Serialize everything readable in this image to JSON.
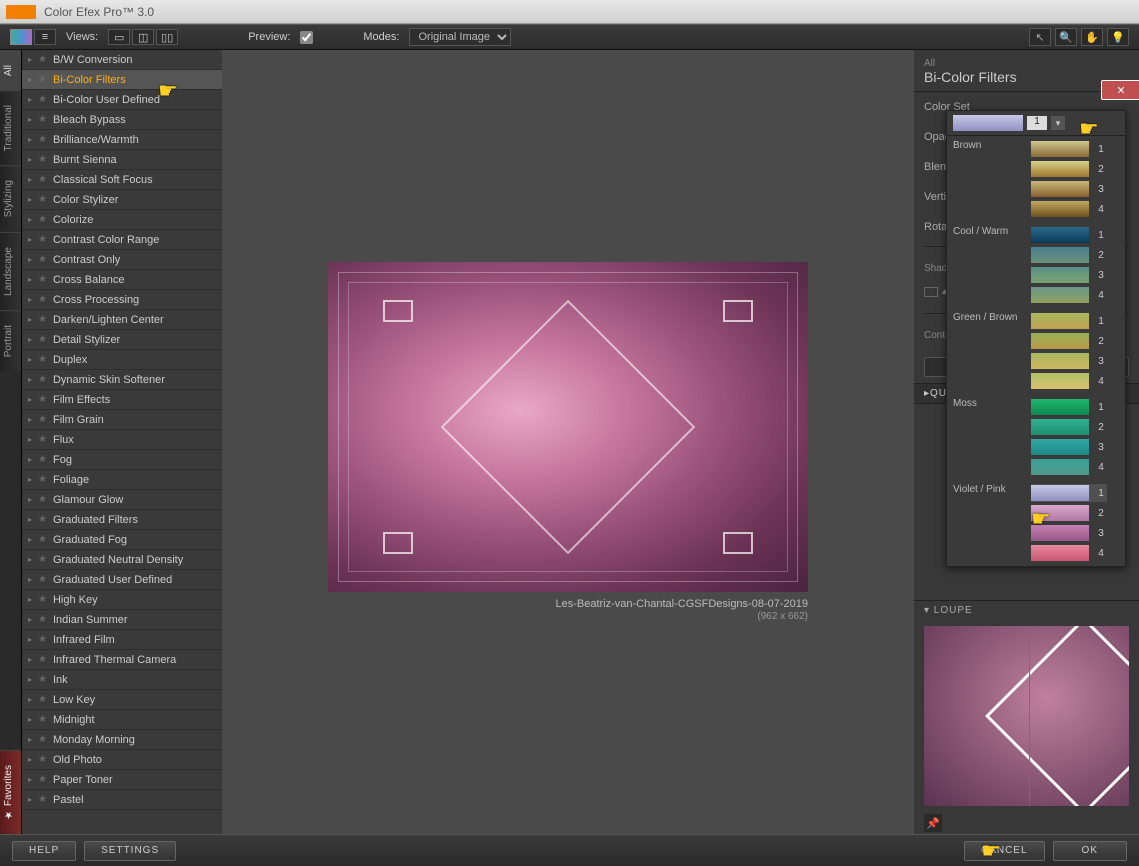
{
  "app_title": "Color Efex Pro™ 3.0",
  "toolbar": {
    "views_label": "Views:",
    "preview_label": "Preview:",
    "preview_checked": true,
    "modes_label": "Modes:",
    "modes_value": "Original Image"
  },
  "vtabs": [
    "All",
    "Traditional",
    "Stylizing",
    "Landscape",
    "Portrait"
  ],
  "vtab_selected": "All",
  "vtab_favorites": "★ Favorites",
  "filters": [
    "B/W Conversion",
    "Bi-Color Filters",
    "Bi-Color User Defined",
    "Bleach Bypass",
    "Brilliance/Warmth",
    "Burnt Sienna",
    "Classical Soft Focus",
    "Color Stylizer",
    "Colorize",
    "Contrast Color Range",
    "Contrast Only",
    "Cross Balance",
    "Cross Processing",
    "Darken/Lighten Center",
    "Detail Stylizer",
    "Duplex",
    "Dynamic Skin Softener",
    "Film Effects",
    "Film Grain",
    "Flux",
    "Fog",
    "Foliage",
    "Glamour Glow",
    "Graduated Filters",
    "Graduated Fog",
    "Graduated Neutral Density",
    "Graduated User Defined",
    "High Key",
    "Indian Summer",
    "Infrared Film",
    "Infrared Thermal Camera",
    "Ink",
    "Low Key",
    "Midnight",
    "Monday Morning",
    "Old Photo",
    "Paper Toner",
    "Pastel"
  ],
  "filter_selected": "Bi-Color Filters",
  "preview": {
    "caption": "Les-Beatriz-van-Chantal-CGSFDesigns-08-07-2019",
    "dims": "(962 x 662)"
  },
  "right": {
    "category": "All",
    "filter_name": "Bi-Color Filters",
    "params": [
      "Color Set",
      "Opacity",
      "Blend",
      "Vertical Shift",
      "Rotation"
    ],
    "shadows_label": "Shadows / Highlights",
    "control_points_label": "Control Points",
    "quick_save": "▸QUICK SAVE",
    "loupe_label": "▾ LOUPE"
  },
  "color_set": {
    "current_value": "1",
    "groups": [
      {
        "name": "Brown",
        "swatches": [
          {
            "n": "1",
            "g": "linear-gradient(#d0c890,#8a6838)"
          },
          {
            "n": "2",
            "g": "linear-gradient(#d8d088,#a07830)"
          },
          {
            "n": "3",
            "g": "linear-gradient(#c8b878,#8a6030)"
          },
          {
            "n": "4",
            "g": "linear-gradient(#c0a860,#705020)"
          }
        ]
      },
      {
        "name": "Cool / Warm",
        "swatches": [
          {
            "n": "1",
            "g": "linear-gradient(#2a6888,#0a3858)"
          },
          {
            "n": "2",
            "g": "linear-gradient(#4a8090,#6a9078)"
          },
          {
            "n": "3",
            "g": "linear-gradient(#5a9088,#7aa070)"
          },
          {
            "n": "4",
            "g": "linear-gradient(#6a988a,#90a060)"
          }
        ]
      },
      {
        "name": "Green / Brown",
        "swatches": [
          {
            "n": "1",
            "g": "linear-gradient(#a8b860,#c0a050)"
          },
          {
            "n": "2",
            "g": "linear-gradient(#98b058,#b89848)"
          },
          {
            "n": "3",
            "g": "linear-gradient(#a8b860,#d0b860)"
          },
          {
            "n": "4",
            "g": "linear-gradient(#b0c068,#d8c070)"
          }
        ]
      },
      {
        "name": "Moss",
        "swatches": [
          {
            "n": "1",
            "g": "linear-gradient(#20b870,#108850)"
          },
          {
            "n": "2",
            "g": "linear-gradient(#30b090,#209070)"
          },
          {
            "n": "3",
            "g": "linear-gradient(#30a8a0,#208888)"
          },
          {
            "n": "4",
            "g": "linear-gradient(#38a098,#509888)"
          }
        ]
      },
      {
        "name": "Violet / Pink",
        "swatches": [
          {
            "n": "1",
            "g": "linear-gradient(#c8c8e8,#9090c0)"
          },
          {
            "n": "2",
            "g": "linear-gradient(#d8a8c8,#b078a8)"
          },
          {
            "n": "3",
            "g": "linear-gradient(#c080b0,#9a5888)"
          },
          {
            "n": "4",
            "g": "linear-gradient(#e888a0,#c85870)"
          }
        ]
      }
    ],
    "selected_group": "Violet / Pink",
    "selected_swatch": "1",
    "top_swatch_gradient": "linear-gradient(#c8c8e8,#9090c0)"
  },
  "bottom": {
    "help": "HELP",
    "settings": "SETTINGS",
    "cancel": "CANCEL",
    "ok": "OK"
  }
}
